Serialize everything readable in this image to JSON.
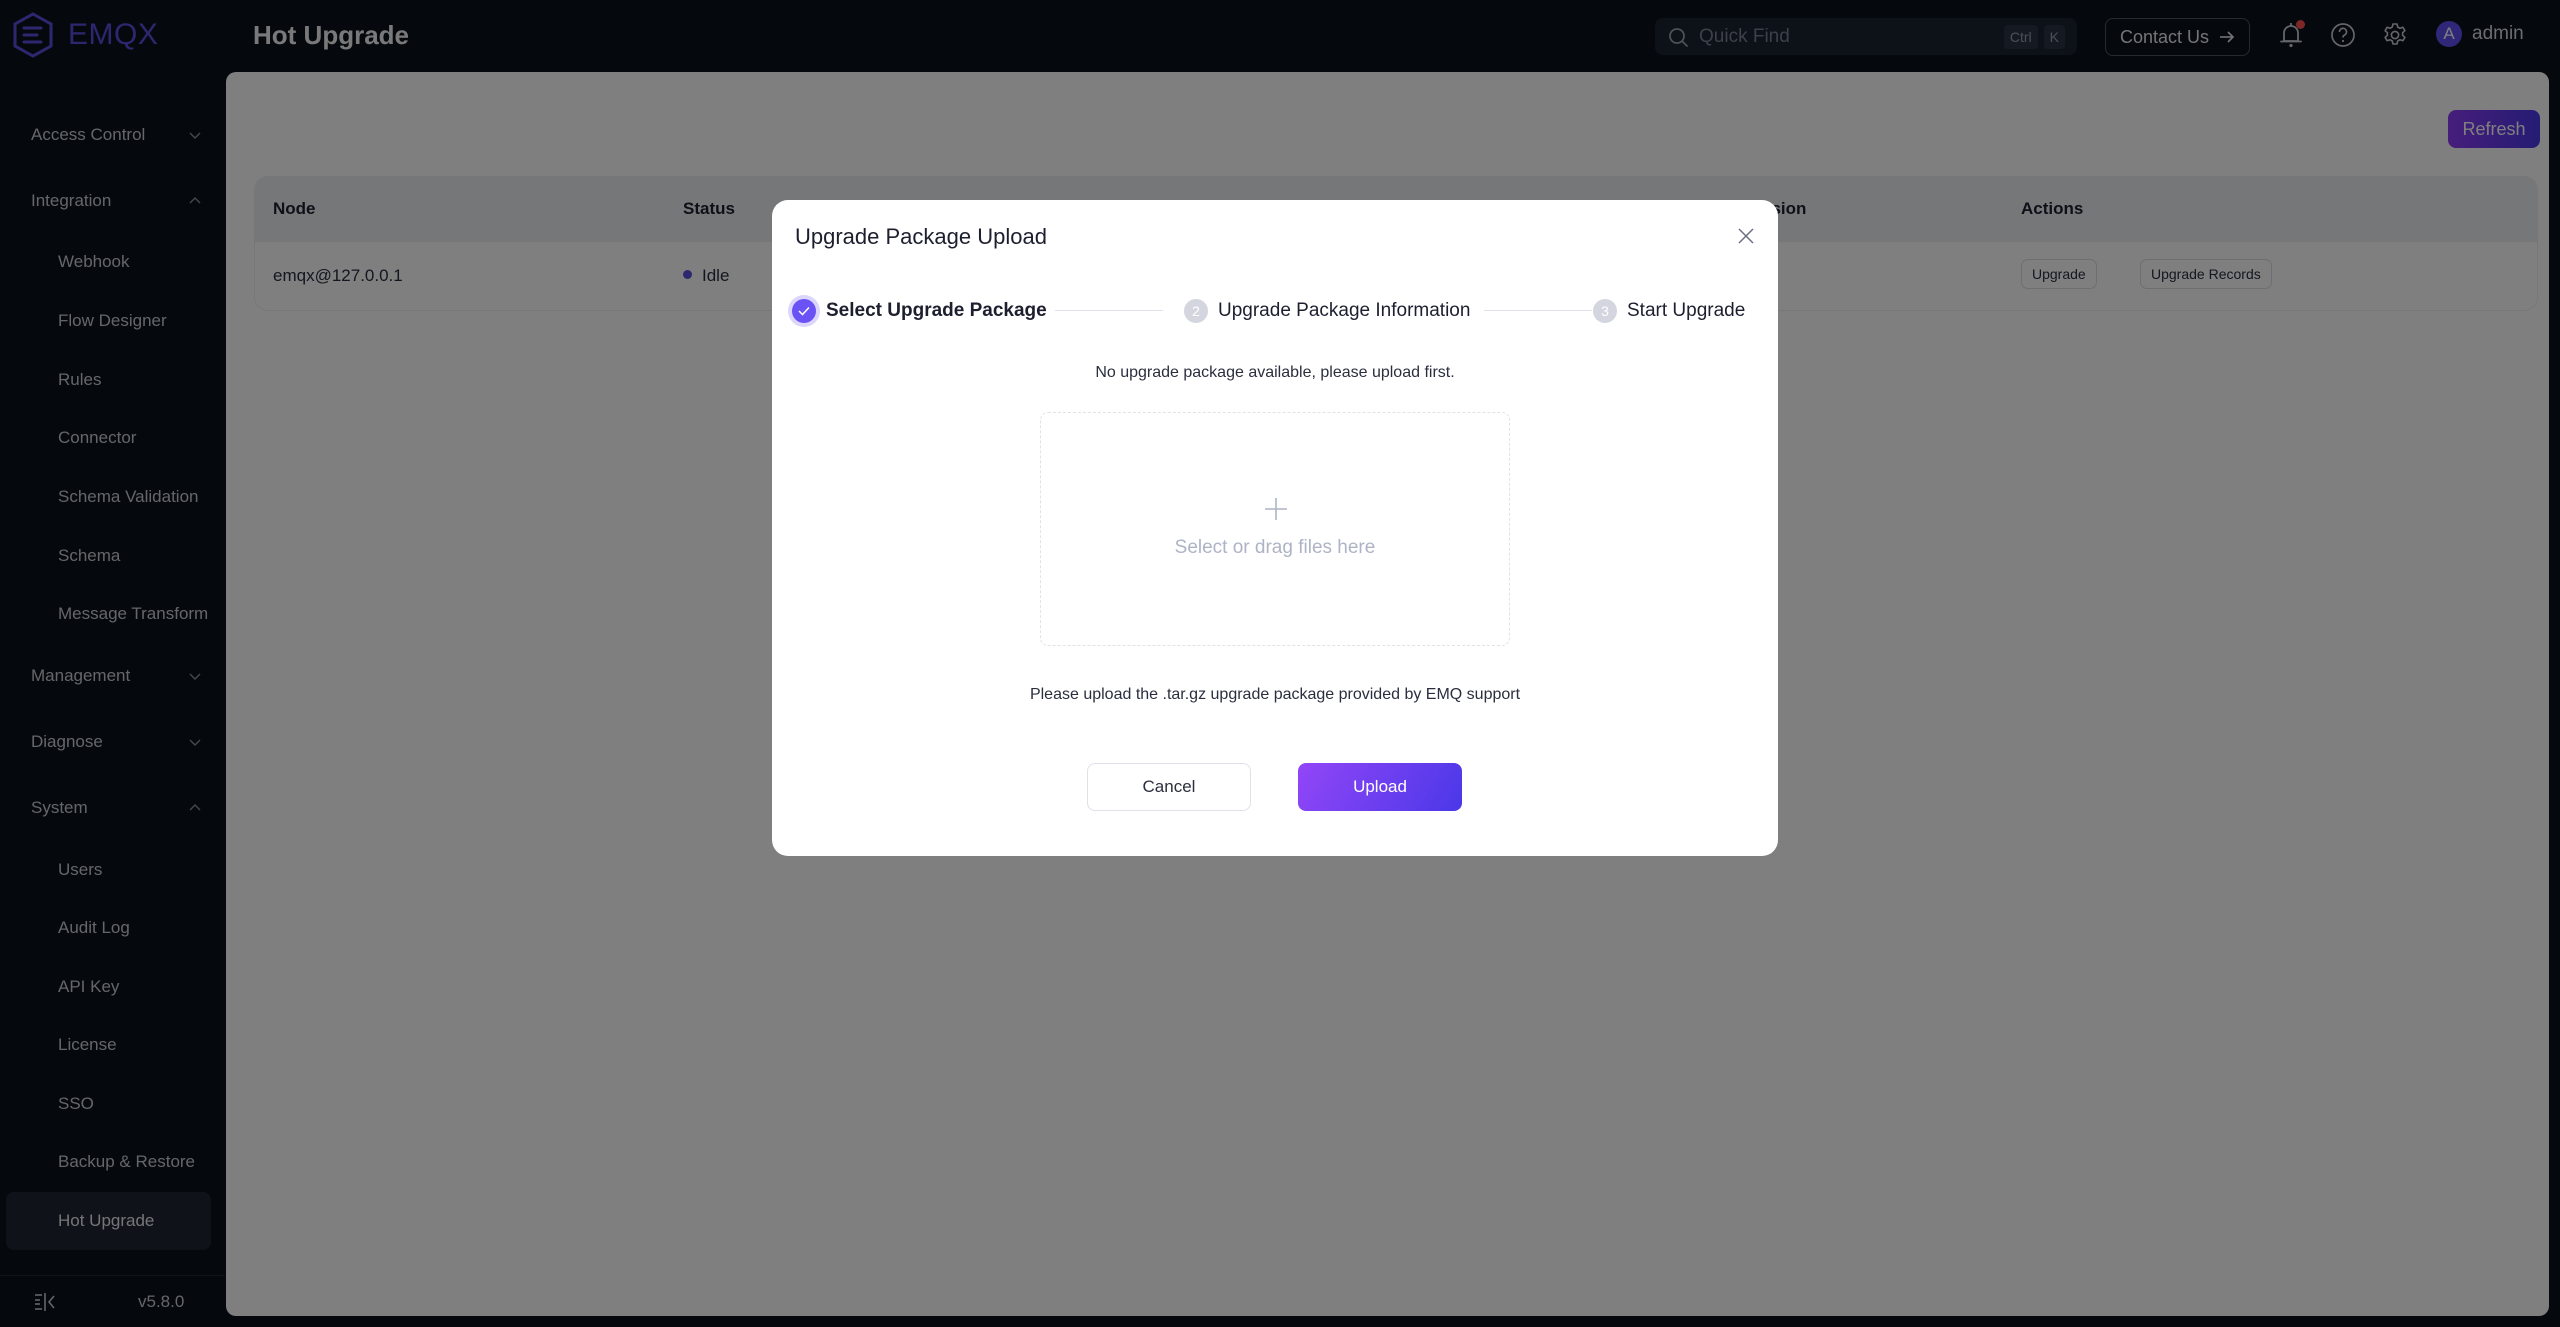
{
  "app": {
    "brand": "EMQX",
    "page_title": "Hot Upgrade",
    "version": "v5.8.0"
  },
  "header": {
    "search_placeholder": "Quick Find",
    "search_shortcut": [
      "Ctrl",
      "K"
    ],
    "contact_label": "Contact Us",
    "has_notification": true,
    "user": {
      "avatar_initial": "A",
      "name": "admin"
    }
  },
  "sidebar": {
    "items": [
      {
        "label": "Access Control",
        "type": "group",
        "expanded": false
      },
      {
        "label": "Integration",
        "type": "group",
        "expanded": true
      },
      {
        "label": "Webhook",
        "type": "sub"
      },
      {
        "label": "Flow Designer",
        "type": "sub"
      },
      {
        "label": "Rules",
        "type": "sub"
      },
      {
        "label": "Connector",
        "type": "sub"
      },
      {
        "label": "Schema Validation",
        "type": "sub"
      },
      {
        "label": "Schema",
        "type": "sub"
      },
      {
        "label": "Message Transform",
        "type": "sub"
      },
      {
        "label": "Management",
        "type": "group",
        "expanded": false
      },
      {
        "label": "Diagnose",
        "type": "group",
        "expanded": false
      },
      {
        "label": "System",
        "type": "group",
        "expanded": true
      },
      {
        "label": "Users",
        "type": "sub"
      },
      {
        "label": "Audit Log",
        "type": "sub"
      },
      {
        "label": "API Key",
        "type": "sub"
      },
      {
        "label": "License",
        "type": "sub"
      },
      {
        "label": "SSO",
        "type": "sub"
      },
      {
        "label": "Backup & Restore",
        "type": "sub"
      },
      {
        "label": "Hot Upgrade",
        "type": "sub",
        "active": true
      }
    ]
  },
  "main": {
    "refresh_label": "Refresh",
    "table": {
      "columns": [
        "Node",
        "Status",
        "Version",
        "Actions"
      ],
      "rows": [
        {
          "node": "emqx@127.0.0.1",
          "status": "Idle",
          "actions": [
            "Upgrade",
            "Upgrade Records"
          ]
        }
      ]
    }
  },
  "dialog": {
    "title": "Upgrade Package Upload",
    "steps": [
      {
        "number": "1",
        "label": "Select Upgrade Package",
        "state": "done"
      },
      {
        "number": "2",
        "label": "Upgrade Package Information",
        "state": "pending"
      },
      {
        "number": "3",
        "label": "Start Upgrade",
        "state": "pending"
      }
    ],
    "empty_message": "No upgrade package available, please upload first.",
    "dropzone_text": "Select or drag files here",
    "hint": "Please upload the .tar.gz upgrade package provided by EMQ support",
    "cancel_label": "Cancel",
    "upload_label": "Upload"
  },
  "colors": {
    "accent": "#5a4fe0",
    "primary_gradient_start": "#9246f7",
    "primary_gradient_end": "#4a38e8",
    "sidebar_bg": "#0a121d",
    "notification": "#ff4d4f"
  }
}
